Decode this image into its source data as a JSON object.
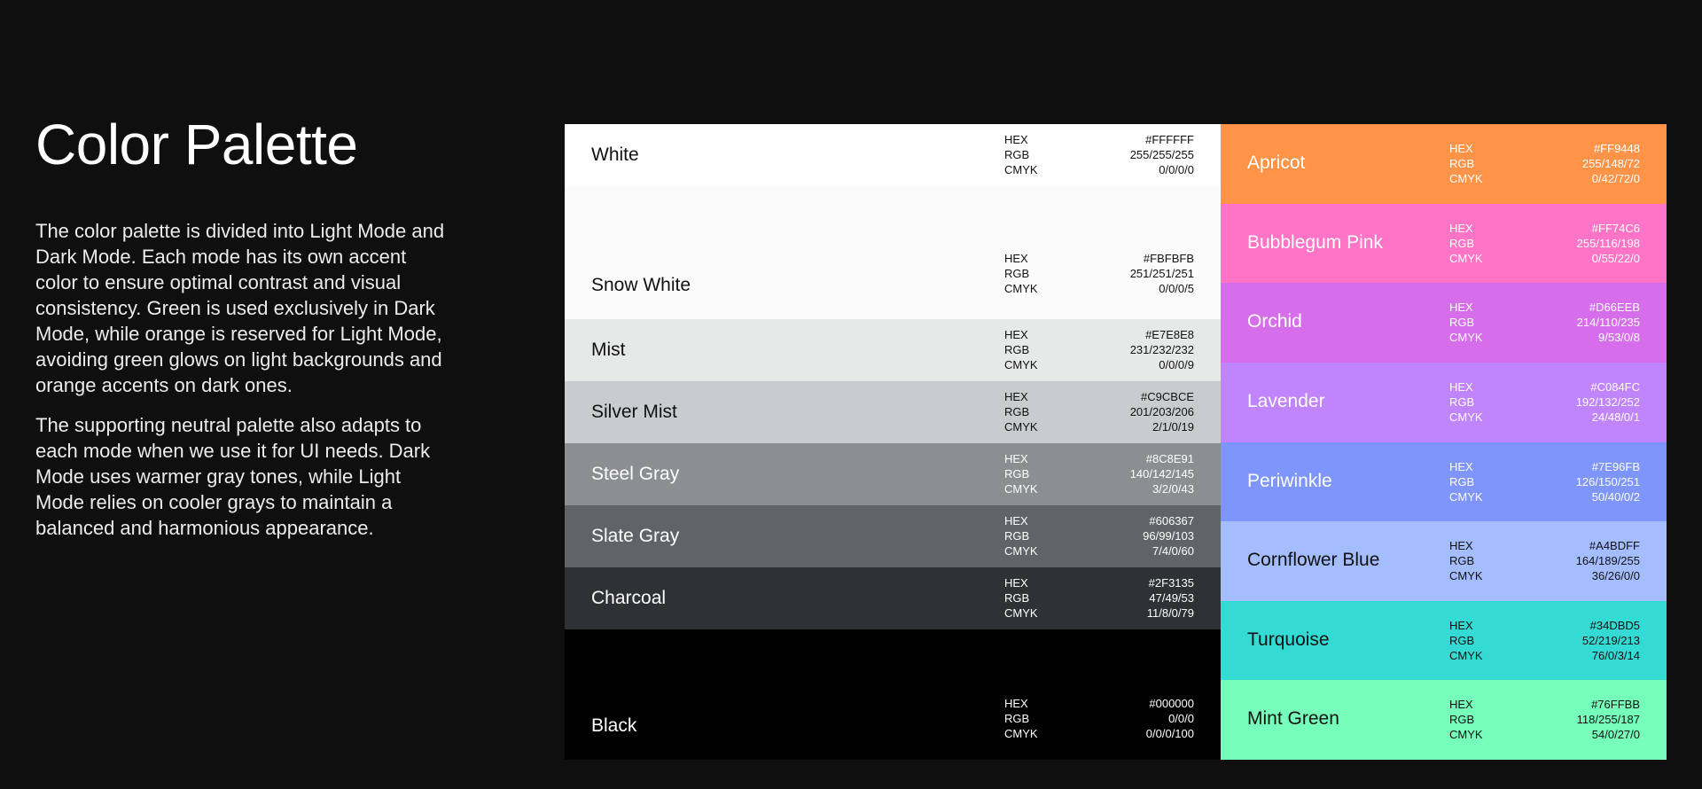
{
  "page": {
    "title": "Color Palette",
    "paragraphs": [
      "The color palette is divided into Light Mode and Dark Mode. Each mode has its own accent color to ensure optimal contrast and visual consistency. Green is used exclusively in Dark Mode, while orange is reserved for Light Mode, avoiding green glows on light backgrounds and orange accents on dark ones.",
      "The supporting neutral palette also adapts to each mode when we use it for UI needs. Dark Mode uses warmer gray tones, while Light Mode relies on cooler grays to maintain a balanced and harmonious appearance."
    ]
  },
  "labels": {
    "hex": "HEX",
    "rgb": "RGB",
    "cmyk": "CMYK"
  },
  "neutrals": [
    {
      "name": "White",
      "hex": "#FFFFFF",
      "rgb": "255/255/255",
      "cmyk": "0/0/0/0",
      "bg": "#FFFFFF",
      "text": "#111111"
    },
    {
      "name": "Snow White",
      "hex": "#FBFBFB",
      "rgb": "251/251/251",
      "cmyk": "0/0/0/5",
      "bg": "#FBFBFB",
      "text": "#111111"
    },
    {
      "name": "Mist",
      "hex": "#E7E8E8",
      "rgb": "231/232/232",
      "cmyk": "0/0/0/9",
      "bg": "#E7E8E8",
      "text": "#111111"
    },
    {
      "name": "Silver Mist",
      "hex": "#C9CBCE",
      "rgb": "201/203/206",
      "cmyk": "2/1/0/19",
      "bg": "#C9CBCE",
      "text": "#111111"
    },
    {
      "name": "Steel Gray",
      "hex": "#8C8E91",
      "rgb": "140/142/145",
      "cmyk": "3/2/0/43",
      "bg": "#8C8E91",
      "text": "#FFFFFF"
    },
    {
      "name": "Slate Gray",
      "hex": "#606367",
      "rgb": "96/99/103",
      "cmyk": "7/4/0/60",
      "bg": "#606367",
      "text": "#FFFFFF"
    },
    {
      "name": "Charcoal",
      "hex": "#2F3135",
      "rgb": "47/49/53",
      "cmyk": "11/8/0/79",
      "bg": "#2F3135",
      "text": "#FFFFFF"
    },
    {
      "name": "Black",
      "hex": "#000000",
      "rgb": "0/0/0",
      "cmyk": "0/0/0/100",
      "bg": "#000000",
      "text": "#FFFFFF"
    }
  ],
  "accents": [
    {
      "name": "Apricot",
      "hex": "#FF9448",
      "rgb": "255/148/72",
      "cmyk": "0/42/72/0",
      "bg": "#FF9448",
      "text": "#FFFFFF"
    },
    {
      "name": "Bubblegum Pink",
      "hex": "#FF74C6",
      "rgb": "255/116/198",
      "cmyk": "0/55/22/0",
      "bg": "#FF74C6",
      "text": "#FFFFFF"
    },
    {
      "name": "Orchid",
      "hex": "#D66EEB",
      "rgb": "214/110/235",
      "cmyk": "9/53/0/8",
      "bg": "#D66EEB",
      "text": "#FFFFFF"
    },
    {
      "name": "Lavender",
      "hex": "#C084FC",
      "rgb": "192/132/252",
      "cmyk": "24/48/0/1",
      "bg": "#C084FC",
      "text": "#FFFFFF"
    },
    {
      "name": "Periwinkle",
      "hex": "#7E96FB",
      "rgb": "126/150/251",
      "cmyk": "50/40/0/2",
      "bg": "#7E96FB",
      "text": "#FFFFFF"
    },
    {
      "name": "Cornflower Blue",
      "hex": "#A4BDFF",
      "rgb": "164/189/255",
      "cmyk": "36/26/0/0",
      "bg": "#A4BDFF",
      "text": "#111111"
    },
    {
      "name": "Turquoise",
      "hex": "#34DBD5",
      "rgb": "52/219/213",
      "cmyk": "76/0/3/14",
      "bg": "#34DBD5",
      "text": "#111111"
    },
    {
      "name": "Mint Green",
      "hex": "#76FFBB",
      "rgb": "118/255/187",
      "cmyk": "54/0/27/0",
      "bg": "#76FFBB",
      "text": "#111111"
    }
  ]
}
